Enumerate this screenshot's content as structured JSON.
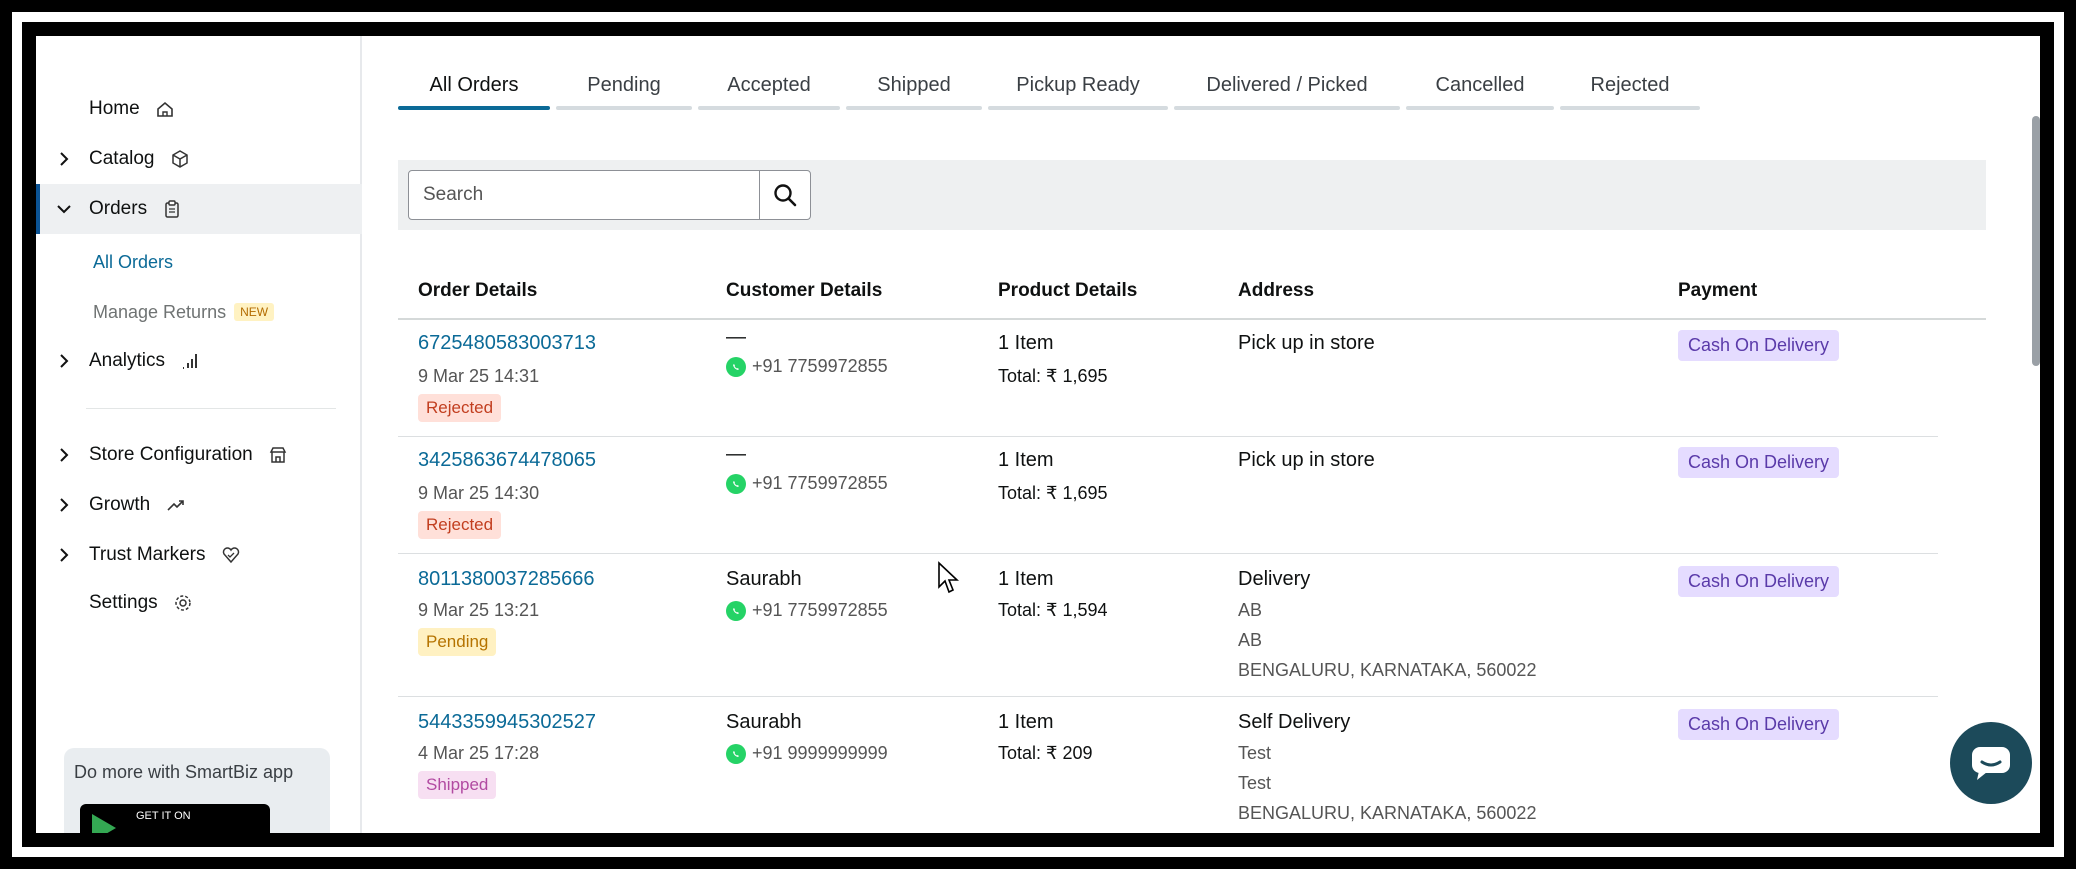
{
  "sidebar": {
    "items": [
      {
        "label": "Home",
        "icon": "home-icon",
        "chevron": ""
      },
      {
        "label": "Catalog",
        "icon": "box-icon",
        "chevron": "right"
      },
      {
        "label": "Orders",
        "icon": "clipboard-icon",
        "chevron": "down"
      },
      {
        "label": "Analytics",
        "icon": "bar-chart-icon",
        "chevron": "right"
      },
      {
        "label": "Store Configuration",
        "icon": "store-icon",
        "chevron": "right"
      },
      {
        "label": "Growth",
        "icon": "trend-up-icon",
        "chevron": "right"
      },
      {
        "label": "Trust Markers",
        "icon": "heart-shield-icon",
        "chevron": "right"
      },
      {
        "label": "Settings",
        "icon": "gear-icon",
        "chevron": ""
      }
    ],
    "orders_sub": {
      "all_orders": "All Orders",
      "manage_returns": "Manage Returns",
      "new_badge": "NEW"
    },
    "promo": {
      "text": "Do more with SmartBiz app",
      "badge": "GET IT ON"
    }
  },
  "tabs": [
    {
      "label": "All Orders",
      "active": true
    },
    {
      "label": "Pending"
    },
    {
      "label": "Accepted"
    },
    {
      "label": "Shipped"
    },
    {
      "label": "Pickup Ready"
    },
    {
      "label": "Delivered / Picked"
    },
    {
      "label": "Cancelled"
    },
    {
      "label": "Rejected"
    }
  ],
  "search": {
    "placeholder": "Search"
  },
  "table": {
    "headers": [
      "Order Details",
      "Customer Details",
      "Product Details",
      "Address",
      "Payment"
    ],
    "rows": [
      {
        "order_id": "6725480583003713",
        "date": "9 Mar 25 14:31",
        "status": "Rejected",
        "customer": "—",
        "phone": "+91 7759972855",
        "items": "1 Item",
        "total": "Total: ₹ 1,695",
        "address_main": "Pick up in store",
        "address_lines": [],
        "payment": "Cash On Delivery"
      },
      {
        "order_id": "3425863674478065",
        "date": "9 Mar 25 14:30",
        "status": "Rejected",
        "customer": "—",
        "phone": "+91 7759972855",
        "items": "1 Item",
        "total": "Total: ₹ 1,695",
        "address_main": "Pick up in store",
        "address_lines": [],
        "payment": "Cash On Delivery"
      },
      {
        "order_id": "8011380037285666",
        "date": "9 Mar 25 13:21",
        "status": "Pending",
        "customer": "Saurabh",
        "phone": "+91 7759972855",
        "items": "1 Item",
        "total": "Total: ₹ 1,594",
        "address_main": "Delivery",
        "address_lines": [
          "AB",
          "AB",
          "BENGALURU, KARNATAKA, 560022"
        ],
        "payment": "Cash On Delivery"
      },
      {
        "order_id": "5443359945302527",
        "date": "4 Mar 25 17:28",
        "status": "Shipped",
        "customer": "Saurabh",
        "phone": "+91 9999999999",
        "items": "1 Item",
        "total": "Total: ₹ 209",
        "address_main": "Self Delivery",
        "address_lines": [
          "Test",
          "Test",
          "BENGALURU, KARNATAKA, 560022"
        ],
        "payment": "Cash On Delivery"
      }
    ]
  },
  "colors": {
    "accent": "#0b6a97",
    "rejected": "#c23e1f",
    "pending": "#b57300",
    "shipped": "#b14aa1",
    "payment": "#5a3aa9",
    "chat_fab": "#1c4a5a"
  }
}
